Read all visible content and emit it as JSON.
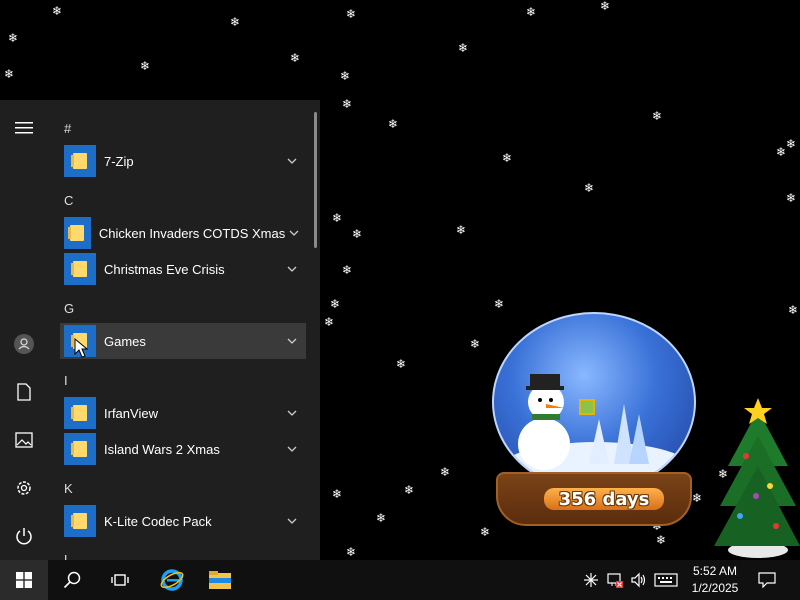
{
  "start_menu": {
    "sections": [
      {
        "letter": "#",
        "apps": [
          "7-Zip"
        ]
      },
      {
        "letter": "C",
        "apps": [
          "Chicken Invaders COTDS Xmas",
          "Christmas Eve Crisis"
        ]
      },
      {
        "letter": "G",
        "apps": [
          "Games"
        ]
      },
      {
        "letter": "I",
        "apps": [
          "IrfanView",
          "Island Wars 2 Xmas"
        ]
      },
      {
        "letter": "K",
        "apps": [
          "K-Lite Codec Pack"
        ]
      },
      {
        "letter": "L",
        "apps": []
      }
    ],
    "hovered_app": "Games"
  },
  "widget": {
    "countdown": "356 days"
  },
  "taskbar": {
    "time": "5:52 AM",
    "date": "1/2/2025"
  },
  "colors": {
    "menu_bg": "#1f1f1f",
    "tile_blue": "#1d6ec9",
    "taskbar_bg": "#101010"
  }
}
